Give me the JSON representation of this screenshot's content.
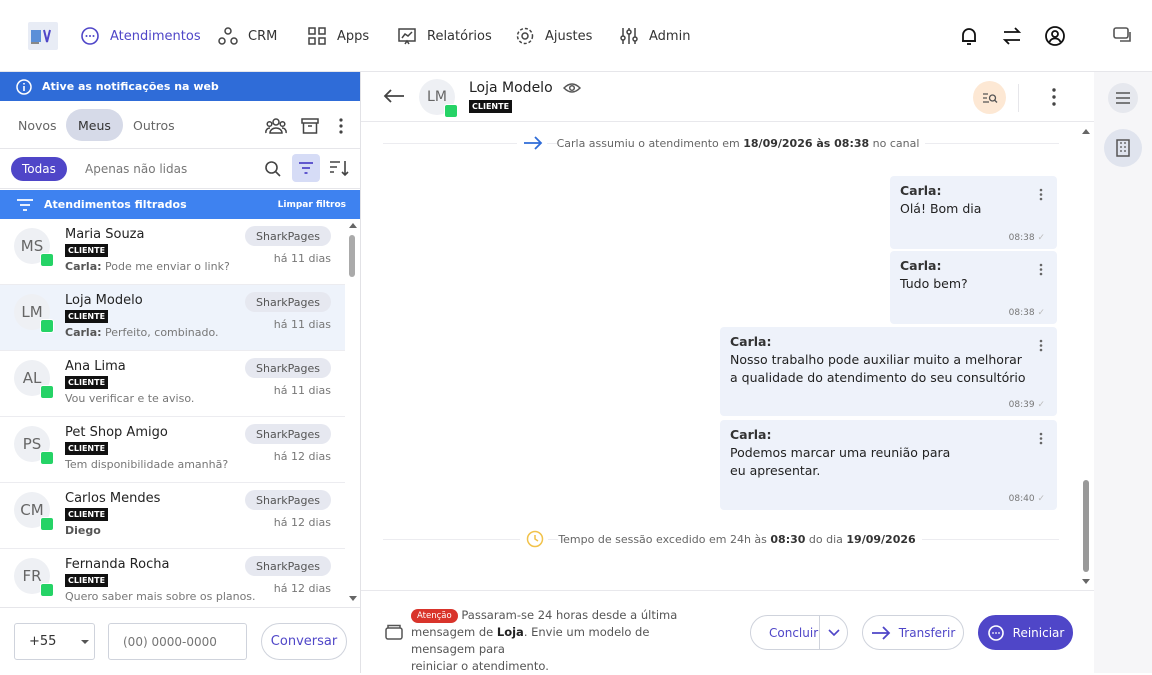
{
  "nav": {
    "items": [
      {
        "label": "Atendimentos",
        "icon": "chat-bubble-icon",
        "active": true
      },
      {
        "label": "CRM",
        "icon": "crm-nodes-icon"
      },
      {
        "label": "Apps",
        "icon": "apps-grid-icon"
      },
      {
        "label": "Relatórios",
        "icon": "report-chart-icon"
      },
      {
        "label": "Ajustes",
        "icon": "gear-icon"
      },
      {
        "label": "Admin",
        "icon": "sliders-icon"
      }
    ],
    "accent": "#4f46c8"
  },
  "notification": {
    "label": "Ative as notificações na web",
    "color": "#2f6cd8"
  },
  "tabs": {
    "novos": "Novos",
    "meus": "Meus",
    "outros": "Outros"
  },
  "filters": {
    "todas": "Todas",
    "nao_lidas": "Apenas não lidas"
  },
  "filtered": {
    "label": "Atendimentos filtrados",
    "clear": "Limpar filtros"
  },
  "conversations": [
    {
      "initials": "MS",
      "name": "Maria Souza",
      "badge": "CLIENTE",
      "sender": "Carla:",
      "preview": " Pode me enviar o link?",
      "tag": "SharkPages",
      "when": "há 11 dias"
    },
    {
      "initials": "LM",
      "name": "Loja Modelo",
      "badge": "CLIENTE",
      "sender": "Carla:",
      "preview": " Perfeito, combinado.",
      "tag": "SharkPages",
      "when": "há 11 dias"
    },
    {
      "initials": "AL",
      "name": "Ana Lima",
      "badge": "CLIENTE",
      "sender": "",
      "preview": "Vou verificar e te aviso.",
      "tag": "SharkPages",
      "when": "há 11 dias"
    },
    {
      "initials": "PS",
      "name": "Pet Shop Amigo",
      "badge": "CLIENTE",
      "sender": "",
      "preview": "Tem disponibilidade amanhã?",
      "tag": "SharkPages",
      "when": "há 12 dias"
    },
    {
      "initials": "CM",
      "name": "Carlos Mendes",
      "badge": "CLIENTE",
      "sender": "Diego",
      "preview": "",
      "tag": "SharkPages",
      "when": "há 12 dias"
    },
    {
      "initials": "FR",
      "name": "Fernanda Rocha",
      "badge": "CLIENTE",
      "sender": "",
      "preview": "Quero saber mais sobre os planos.",
      "tag": "SharkPages",
      "when": "há 12 dias"
    }
  ],
  "newchat": {
    "country": "+55",
    "phone_placeholder": "(00) 0000-0000",
    "button": "Conversar"
  },
  "chat": {
    "initials": "LM",
    "name": "Loja Modelo",
    "badge": "CLIENTE",
    "system1": {
      "pre": "Carla assumiu o atendimento em ",
      "date": "18/09/2026 às 08:38",
      "post": " no canal"
    },
    "messages": [
      {
        "who": "Carla:",
        "text": "Olá! Bom dia",
        "time": "08:38"
      },
      {
        "who": "Carla:",
        "text": "Tudo bem?",
        "time": "08:38"
      },
      {
        "who": "Carla:",
        "text": "Nosso trabalho pode auxiliar muito a melhorar a qualidade do atendimento do seu consultório",
        "time": "08:39"
      },
      {
        "who": "Carla:",
        "text": "Podemos marcar uma reunião para eu apresentar.",
        "time": "08:40"
      }
    ],
    "system2": {
      "pre": "Tempo de sessão excedido em 24h às ",
      "time": "08:30",
      "mid": " do dia ",
      "date": "19/09/2026"
    }
  },
  "footer": {
    "attention": "Atenção",
    "text1": "Passaram-se 24 horas desde a última",
    "text2a": "mensagem de ",
    "text2b": "Loja",
    "text2c": ". Envie um modelo de mensagem para",
    "text3": "reiniciar o atendimento.",
    "concluir": "Concluir",
    "transferir": "Transferir",
    "reiniciar": "Reiniciar"
  }
}
